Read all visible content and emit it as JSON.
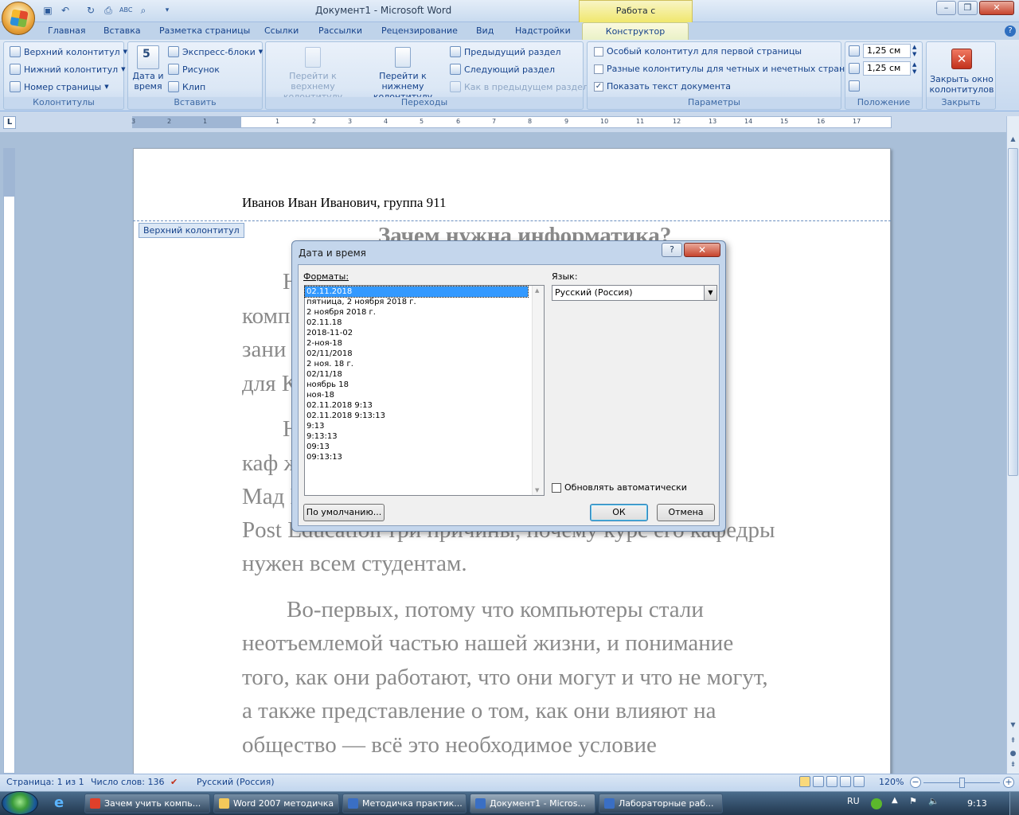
{
  "window": {
    "doc_title": "Документ1 - Microsoft Word",
    "context_tab_title": "Работа с колонтитулами"
  },
  "ribbon_tabs": [
    "Главная",
    "Вставка",
    "Разметка страницы",
    "Ссылки",
    "Рассылки",
    "Рецензирование",
    "Вид",
    "Надстройки"
  ],
  "active_tab": "Конструктор",
  "groups": {
    "headers": {
      "label": "Колонтитулы",
      "items": [
        "Верхний колонтитул",
        "Нижний колонтитул",
        "Номер страницы"
      ]
    },
    "insert": {
      "label": "Вставить",
      "date_time_line1": "Дата и",
      "date_time_line2": "время",
      "items": [
        "Экспресс-блоки",
        "Рисунок",
        "Клип"
      ]
    },
    "navigation": {
      "label": "Переходы",
      "goto_header_line1": "Перейти к верхнему",
      "goto_header_line2": "колонтитулу",
      "goto_footer_line1": "Перейти к нижнему",
      "goto_footer_line2": "колонтитулу",
      "items": [
        "Предыдущий раздел",
        "Следующий раздел",
        "Как в предыдущем разделе"
      ]
    },
    "options": {
      "label": "Параметры",
      "items": [
        {
          "label": "Особый колонтитул для первой страницы",
          "checked": false
        },
        {
          "label": "Разные колонтитулы для четных и нечетных страниц",
          "checked": false
        },
        {
          "label": "Показать текст документа",
          "checked": true
        }
      ]
    },
    "position": {
      "label": "Положение",
      "top_value": "1,25 см",
      "bottom_value": "1,25 см"
    },
    "close": {
      "label": "Закрыть",
      "button_line1": "Закрыть окно",
      "button_line2": "колонтитулов"
    }
  },
  "ruler_ticks": [
    "3",
    "2",
    "1",
    "1",
    "2",
    "3",
    "4",
    "5",
    "6",
    "7",
    "8",
    "9",
    "10",
    "11",
    "12",
    "13",
    "14",
    "15",
    "16",
    "17"
  ],
  "document": {
    "header_text": "Иванов Иван Иванович, группа 911",
    "header_label": "Верхний колонтитул",
    "heading": "Зачем нужна информатика?",
    "lines": [
      "Н                                                  акомить с",
      "комп                                             обирается",
      "зани                                             не только",
      "для К",
      "Н                                                 ведующий",
      "каф                                             же Харви",
      "Мад                                          Huffington",
      "Post Education три причины, почему курс его кафедры",
      "нужен всем студентам.",
      "Во-первых, потому что компьютеры стали",
      "неотъемлемой частью нашей жизни, и понимание",
      "того, как они работают, что они могут и что не могут,",
      "а также представление о том, как они влияют на",
      "общество — всё это необходимое условие"
    ]
  },
  "dialog": {
    "title": "Дата и время",
    "help": "?",
    "formats_label": "Форматы:",
    "formats": [
      "02.11.2018",
      "пятница, 2 ноября 2018 г.",
      "2 ноября 2018 г.",
      "02.11.18",
      "2018-11-02",
      "2-ноя-18",
      "02/11/2018",
      "2 ноя. 18 г.",
      "02/11/18",
      "ноябрь 18",
      "ноя-18",
      "02.11.2018 9:13",
      "02.11.2018 9:13:13",
      "9:13",
      "9:13:13",
      "09:13",
      "09:13:13"
    ],
    "selected_index": 0,
    "language_label": "Язык:",
    "language_value": "Русский (Россия)",
    "auto_update_label": "Обновлять автоматически",
    "auto_update_checked": false,
    "default_button": "По умолчанию...",
    "ok_button": "ОК",
    "cancel_button": "Отмена"
  },
  "statusbar": {
    "page": "Страница: 1 из 1",
    "words": "Число слов: 136",
    "language": "Русский (Россия)",
    "zoom": "120%"
  },
  "taskbar": {
    "tasks": [
      {
        "label": "Зачем учить компь...",
        "color": "#e0402a"
      },
      {
        "label": "Word 2007 методичка",
        "color": "#f3c85a"
      },
      {
        "label": "Методичка практик...",
        "color": "#3a6fc4"
      },
      {
        "label": "Документ1 - Micros...",
        "color": "#3a6fc4"
      },
      {
        "label": "Лабораторные раб...",
        "color": "#3a6fc4"
      }
    ],
    "active_index": 3,
    "lang": "RU",
    "time": "9:13"
  }
}
